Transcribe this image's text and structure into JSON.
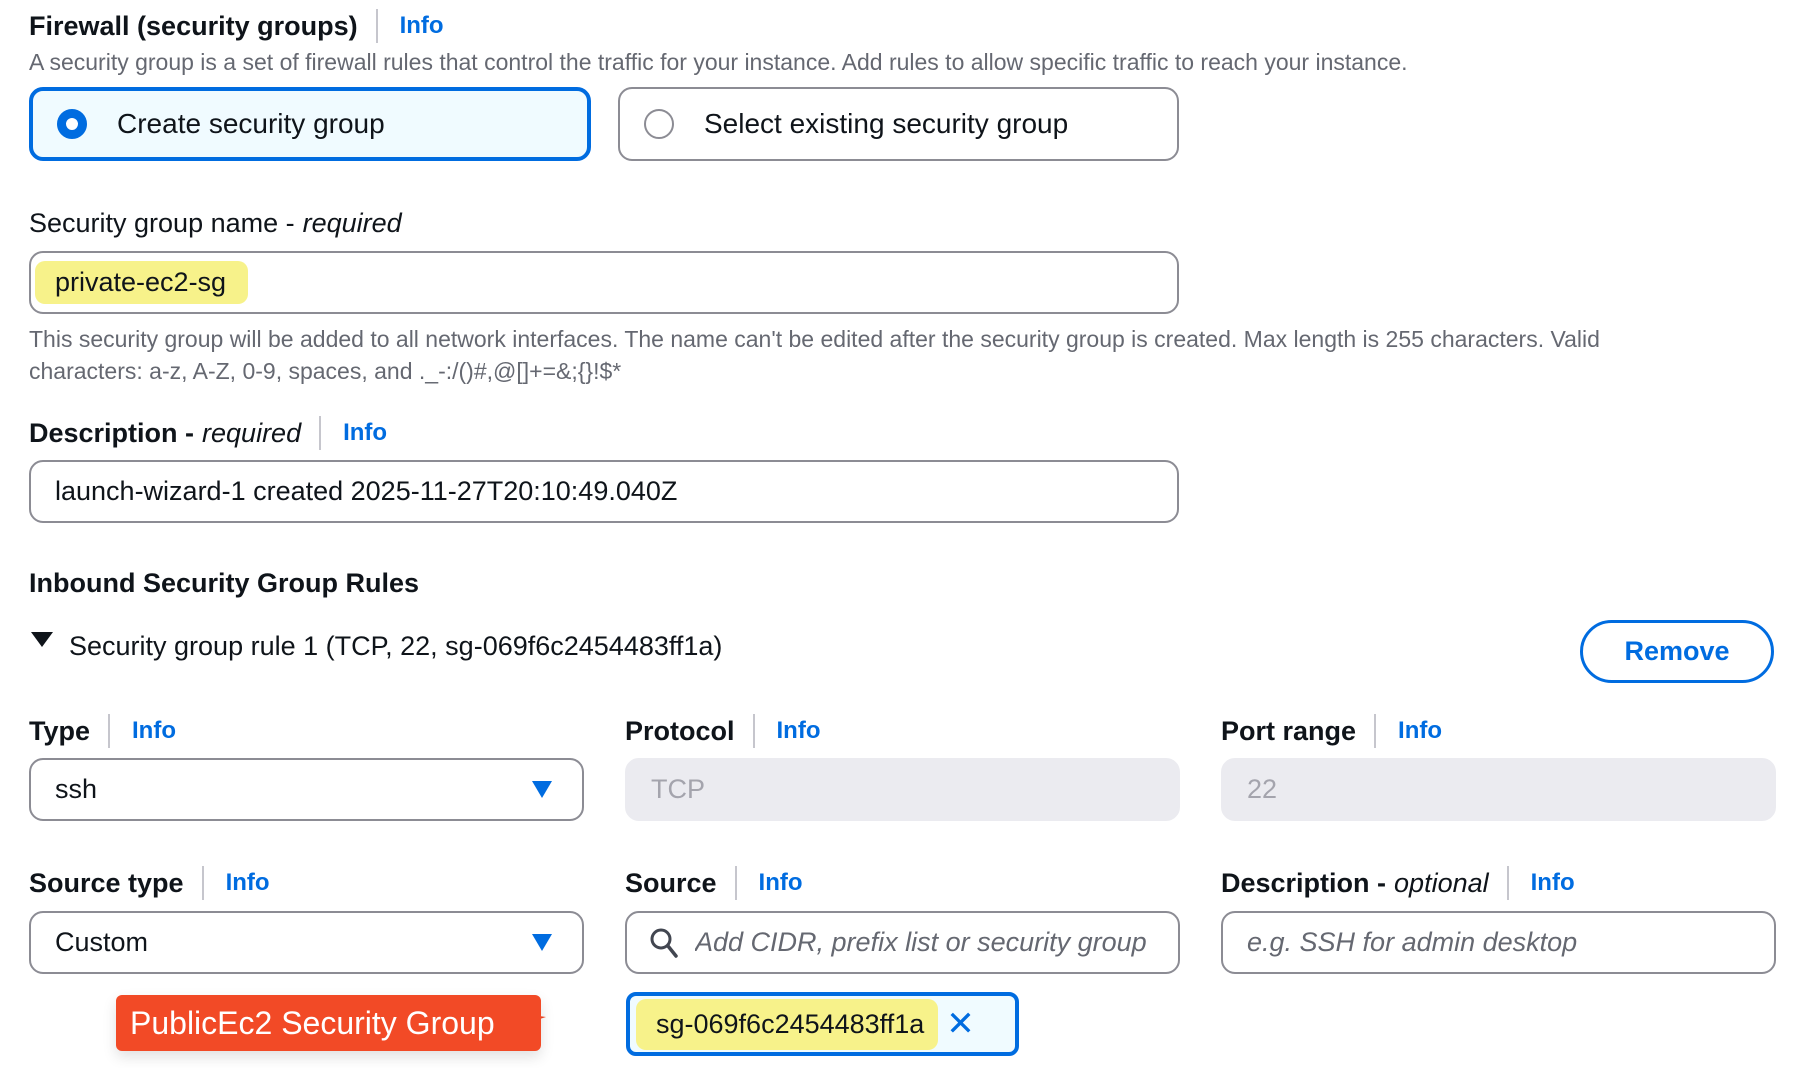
{
  "firewall": {
    "title": "Firewall (security groups)",
    "info": "Info",
    "description": "A security group is a set of firewall rules that control the traffic for your instance. Add rules to allow specific traffic to reach your instance.",
    "options": [
      {
        "label": "Create security group",
        "selected": true
      },
      {
        "label": "Select existing security group",
        "selected": false
      }
    ]
  },
  "sg_name": {
    "label": "Security group name -",
    "qualifier": "required",
    "value": "private-ec2-sg",
    "help1": "This security group will be added to all network interfaces. The name can't be edited after the security group is created. Max length is 255 characters. Valid",
    "help2": "characters: a-z, A-Z, 0-9, spaces, and ._-:/()#,@[]+=&;{}!$*"
  },
  "description": {
    "label": "Description -",
    "qualifier": "required",
    "info": "Info",
    "value": "launch-wizard-1 created 2025-11-27T20:10:49.040Z"
  },
  "inbound": {
    "heading": "Inbound Security Group Rules",
    "rule_title": "Security group rule 1 (TCP, 22, sg-069f6c2454483ff1a)",
    "remove": "Remove",
    "type": {
      "label": "Type",
      "info": "Info",
      "value": "ssh"
    },
    "protocol": {
      "label": "Protocol",
      "info": "Info",
      "value": "TCP"
    },
    "port_range": {
      "label": "Port range",
      "info": "Info",
      "value": "22"
    },
    "source_type": {
      "label": "Source type",
      "info": "Info",
      "value": "Custom"
    },
    "source": {
      "label": "Source",
      "info": "Info",
      "placeholder": "Add CIDR, prefix list or security group",
      "token": "sg-069f6c2454483ff1a"
    },
    "rule_description": {
      "label": "Description -",
      "qualifier": "optional",
      "info": "Info",
      "placeholder": "e.g. SSH for admin desktop"
    }
  },
  "annotation": {
    "text": "PublicEc2 Security Group",
    "color": "#f24a26"
  }
}
